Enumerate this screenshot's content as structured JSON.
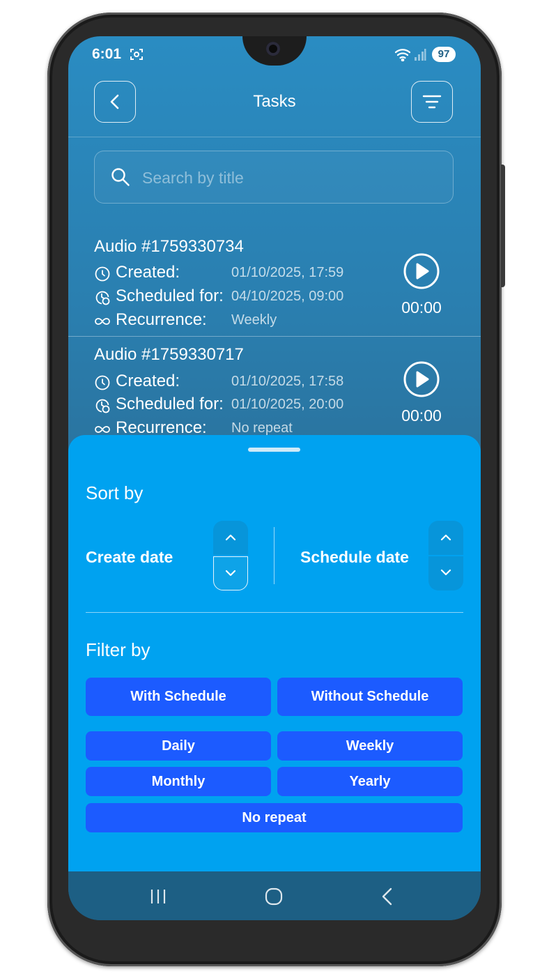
{
  "status_bar": {
    "time": "6:01",
    "battery": "97"
  },
  "header": {
    "title": "Tasks",
    "back_icon": "chevron-left-icon",
    "filter_icon": "filter-icon"
  },
  "search": {
    "placeholder": "Search by title",
    "value": ""
  },
  "tasks": [
    {
      "title": "Audio #1759330734",
      "created_label": "Created:",
      "created": "01/10/2025, 17:59",
      "scheduled_label": "Scheduled for:",
      "scheduled": "04/10/2025, 09:00",
      "recurrence_label": "Recurrence:",
      "recurrence": "Weekly",
      "duration": "00:00"
    },
    {
      "title": "Audio #1759330717",
      "created_label": "Created:",
      "created": "01/10/2025, 17:58",
      "scheduled_label": "Scheduled for:",
      "scheduled": "01/10/2025, 20:00",
      "recurrence_label": "Recurrence:",
      "recurrence": "No repeat",
      "duration": "00:00"
    }
  ],
  "sheet": {
    "sort_title": "Sort by",
    "sort_create": "Create date",
    "sort_schedule": "Schedule date",
    "filter_title": "Filter by",
    "filters": {
      "with_schedule": "With Schedule",
      "without_schedule": "Without Schedule",
      "daily": "Daily",
      "weekly": "Weekly",
      "monthly": "Monthly",
      "yearly": "Yearly",
      "no_repeat": "No repeat"
    }
  },
  "colors": {
    "sheet": "#00a2f0",
    "filter_button": "#1c5bff",
    "nav_bar": "#1d5f84"
  }
}
